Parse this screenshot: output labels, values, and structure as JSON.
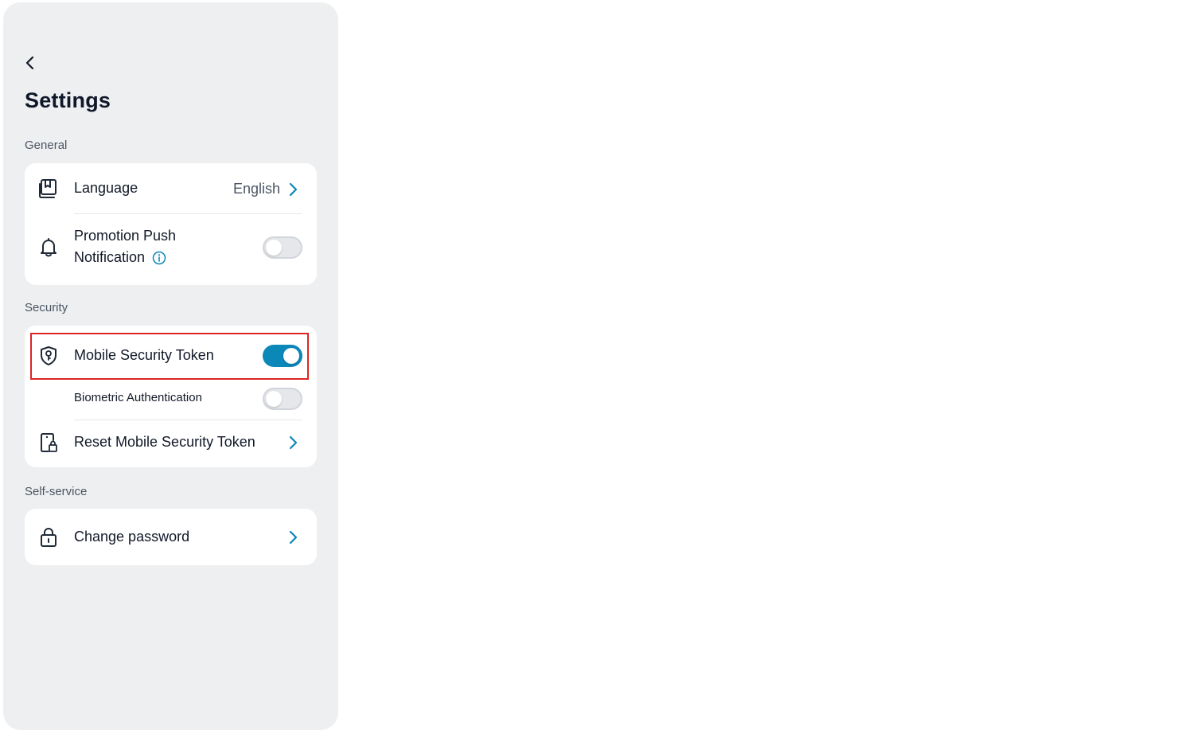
{
  "header": {
    "title": "Settings"
  },
  "sections": {
    "general": {
      "label": "General",
      "language": {
        "label": "Language",
        "value": "English"
      },
      "promotion": {
        "label_line1": "Promotion Push",
        "label_line2": "Notification",
        "enabled": false
      }
    },
    "security": {
      "label": "Security",
      "mobile_token": {
        "label": "Mobile Security Token",
        "enabled": true
      },
      "biometric": {
        "label": "Biometric Authentication",
        "enabled": false
      },
      "reset": {
        "label": "Reset Mobile Security Token"
      }
    },
    "self_service": {
      "label": "Self-service",
      "change_password": {
        "label": "Change password"
      }
    }
  },
  "colors": {
    "accent": "#0b87b8",
    "highlight": "#dc2626",
    "panel_bg": "#eeeff0",
    "card_bg": "#ffffff"
  },
  "icons": {
    "back": "chevron-left-icon",
    "language": "language-icon",
    "promotion": "bell-icon",
    "info": "info-icon",
    "mobile_token": "shield-key-icon",
    "reset": "phone-lock-icon",
    "change_password": "lock-icon",
    "row_arrow": "chevron-right-icon"
  }
}
